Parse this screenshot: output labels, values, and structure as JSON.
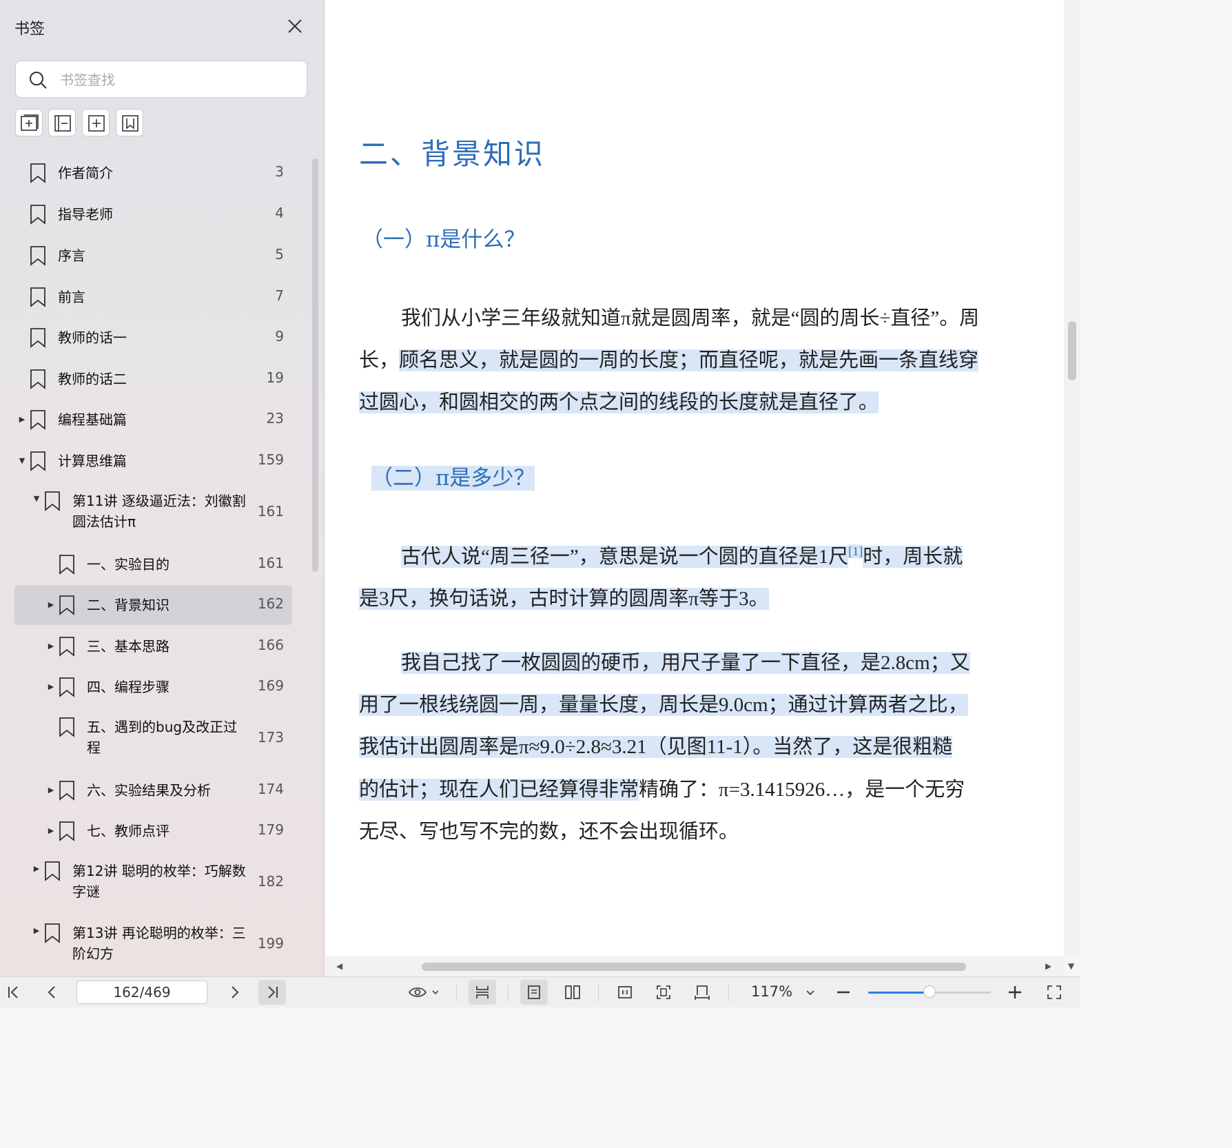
{
  "sidebar": {
    "title": "书签",
    "search_placeholder": "书签查找",
    "items": [
      {
        "label": "作者简介",
        "page": "3",
        "indent": 0,
        "expander": "none"
      },
      {
        "label": "指导老师",
        "page": "4",
        "indent": 0,
        "expander": "none"
      },
      {
        "label": "序言",
        "page": "5",
        "indent": 0,
        "expander": "none"
      },
      {
        "label": "前言",
        "page": "7",
        "indent": 0,
        "expander": "none"
      },
      {
        "label": "教师的话一",
        "page": "9",
        "indent": 0,
        "expander": "none"
      },
      {
        "label": "教师的话二",
        "page": "19",
        "indent": 0,
        "expander": "none"
      },
      {
        "label": "编程基础篇",
        "page": "23",
        "indent": 0,
        "expander": "collapsed"
      },
      {
        "label": "计算思维篇",
        "page": "159",
        "indent": 0,
        "expander": "expanded"
      },
      {
        "label": "第11讲 逐级逼近法：刘徽割\n圆法估计π",
        "page": "161",
        "indent": 1,
        "expander": "expanded"
      },
      {
        "label": "一、实验目的",
        "page": "161",
        "indent": 2,
        "expander": "none"
      },
      {
        "label": "二、背景知识",
        "page": "162",
        "indent": 2,
        "expander": "collapsed",
        "selected": true
      },
      {
        "label": "三、基本思路",
        "page": "166",
        "indent": 2,
        "expander": "collapsed"
      },
      {
        "label": "四、编程步骤",
        "page": "169",
        "indent": 2,
        "expander": "collapsed"
      },
      {
        "label": "五、遇到的bug及改正过\n程",
        "page": "173",
        "indent": 2,
        "expander": "none"
      },
      {
        "label": "六、实验结果及分析",
        "page": "174",
        "indent": 2,
        "expander": "collapsed"
      },
      {
        "label": "七、教师点评",
        "page": "179",
        "indent": 2,
        "expander": "collapsed"
      },
      {
        "label": "第12讲 聪明的枚举：巧解数\n字谜",
        "page": "182",
        "indent": 1,
        "expander": "collapsed"
      },
      {
        "label": "第13讲 再论聪明的枚举：三\n阶幻方",
        "page": "199",
        "indent": 1,
        "expander": "collapsed"
      }
    ]
  },
  "document": {
    "heading": "二、背景知识",
    "section1_title": "（一）π是什么？",
    "p1_l1": "我们从小学三年级就知道π就是圆周率，就是“圆的周长÷直径”。周",
    "p1_l2a": "长，",
    "p1_l2b": "顾名思义，就是圆的一周的长度；而直径呢，就是先画一条直线穿",
    "p1_l3": "过圆心，和圆相交的两个点之间的线段的长度就是直径了。",
    "section2_title": "（二）π是多少？",
    "p2_l1a": "古代人说“周三径一”，意思是说一个圆的直径是1尺",
    "p2_fn": "[1]",
    "p2_l1b": "时，周长就",
    "p2_l2": "是3尺，换句话说，古时计算的圆周率π等于3。",
    "p3_l1": "我自己找了一枚圆圆的硬币，用尺子量了一下直径，是2.8cm；又",
    "p3_l2": "用了一根线绕圆一周，量量长度，周长是9.0cm；通过计算两者之比，",
    "p3_l3": "我估计出圆周率是π≈9.0÷2.8≈3.21（见图11-1）。当然了，这是很粗糙",
    "p3_l4a": "的估计；现在人们已经算得非常",
    "p3_l4b": "精确了：π=3.1415926…，是一个无穷",
    "p3_l5": "无尽、写也写不完的数，还不会出现循环。"
  },
  "bottombar": {
    "page_value": "162/469",
    "zoom_label": "117%",
    "zoom_level": 0.5
  },
  "colors": {
    "heading": "#2d6db7",
    "highlight": "#d8e6f8",
    "accent": "#2b7be6"
  }
}
